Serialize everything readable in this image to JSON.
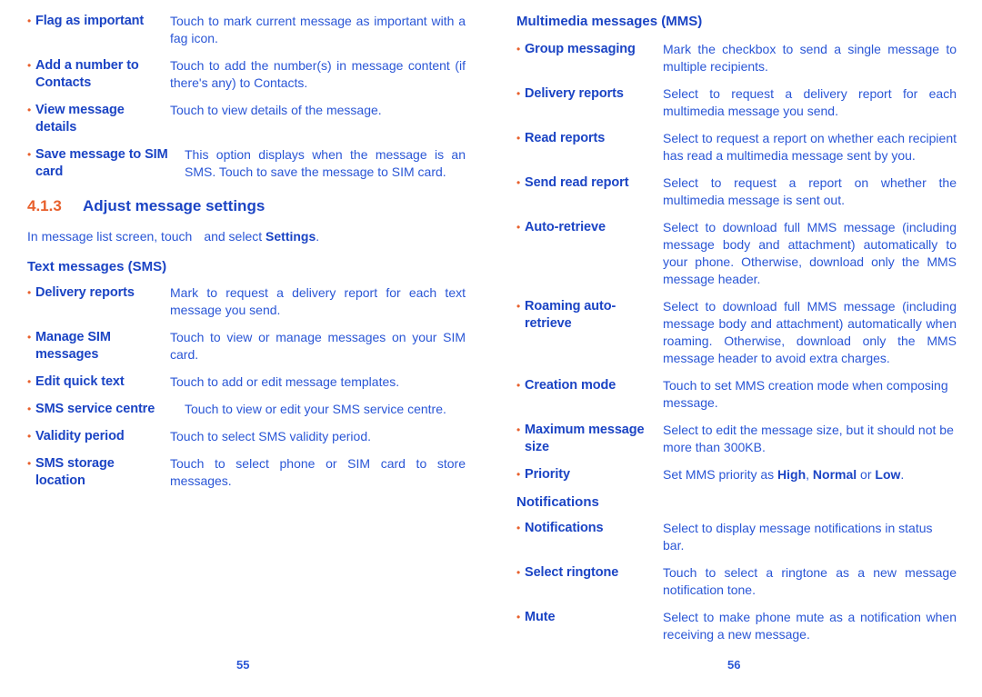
{
  "bullet_glyph": "•",
  "colors": {
    "text_blue": "#2a56d6",
    "term_blue": "#1b44c4",
    "bullet_orange": "#e8602c",
    "section_number_orange": "#e8602c",
    "background": "#ffffff"
  },
  "left_page": {
    "folio": "55",
    "top_rows": [
      {
        "term": "Flag as important",
        "desc": "Touch to mark current message as important with a fag icon."
      },
      {
        "term": "Add a number to Contacts",
        "desc": "Touch to add the number(s) in message content (if there's any) to Contacts."
      },
      {
        "term": "View message details",
        "desc": "Touch to view details of the message."
      },
      {
        "term": "Save message to SIM card",
        "desc": "This option displays when the message is an SMS. Touch to save the message to SIM card."
      }
    ],
    "section": {
      "number": "4.1.3",
      "title": "Adjust message settings"
    },
    "intro": {
      "before_icon": "In message list screen, touch",
      "after_icon": "and select",
      "bold_word": "Settings",
      "trailing": "."
    },
    "sms_heading": "Text messages (SMS)",
    "sms_rows": [
      {
        "term": "Delivery reports",
        "desc": "Mark to request a delivery report for each text message you send."
      },
      {
        "term": "Manage SIM messages",
        "desc": "Touch to view or manage messages on your SIM card."
      },
      {
        "term": "Edit quick text",
        "desc": "Touch to add or edit message templates."
      },
      {
        "term": "SMS service centre",
        "desc": "Touch to view or edit your SMS service centre."
      },
      {
        "term": "Validity period",
        "desc": "Touch to select SMS validity period."
      },
      {
        "term": "SMS storage location",
        "desc": "Touch to select phone or SIM card to store messages."
      }
    ]
  },
  "right_page": {
    "folio": "56",
    "mms_heading": "Multimedia messages (MMS)",
    "mms_rows": [
      {
        "term": "Group messaging",
        "desc": "Mark the checkbox to send a single message to multiple recipients."
      },
      {
        "term": "Delivery reports",
        "desc": "Select to request a delivery report for each multimedia message you send."
      },
      {
        "term": "Read reports",
        "desc": "Select to request a report on whether each recipient has read a multimedia message sent by you."
      },
      {
        "term": "Send read report",
        "desc": "Select to request a report on whether the multimedia message is sent out."
      },
      {
        "term": "Auto-retrieve",
        "desc": "Select to download full MMS message (including message body and attachment) automatically to your phone. Otherwise, download only the MMS message header."
      },
      {
        "term": "Roaming auto-retrieve",
        "desc": "Select to download full MMS message (including message body and attachment) automatically when roaming. Otherwise, download only the MMS message header to avoid extra charges."
      },
      {
        "term": "Creation mode",
        "desc": "Touch to set MMS creation mode when composing message."
      },
      {
        "term": "Maximum message size",
        "desc": "Select to edit the message size, but it should not be more than 300KB."
      }
    ],
    "priority_row": {
      "term": "Priority",
      "desc_prefix": "Set MMS priority as ",
      "option_high": "High",
      "sep1": ", ",
      "option_normal": "Normal",
      "sep2": " or ",
      "option_low": "Low",
      "desc_suffix": "."
    },
    "notifications_heading": "Notifications",
    "notification_rows": [
      {
        "term": "Notifications",
        "desc": "Select to display message notifications in status bar."
      },
      {
        "term": "Select ringtone",
        "desc": "Touch to select a ringtone as a new message notification tone."
      },
      {
        "term": "Mute",
        "desc": "Select to make phone mute as a notification when receiving a new message."
      }
    ]
  }
}
